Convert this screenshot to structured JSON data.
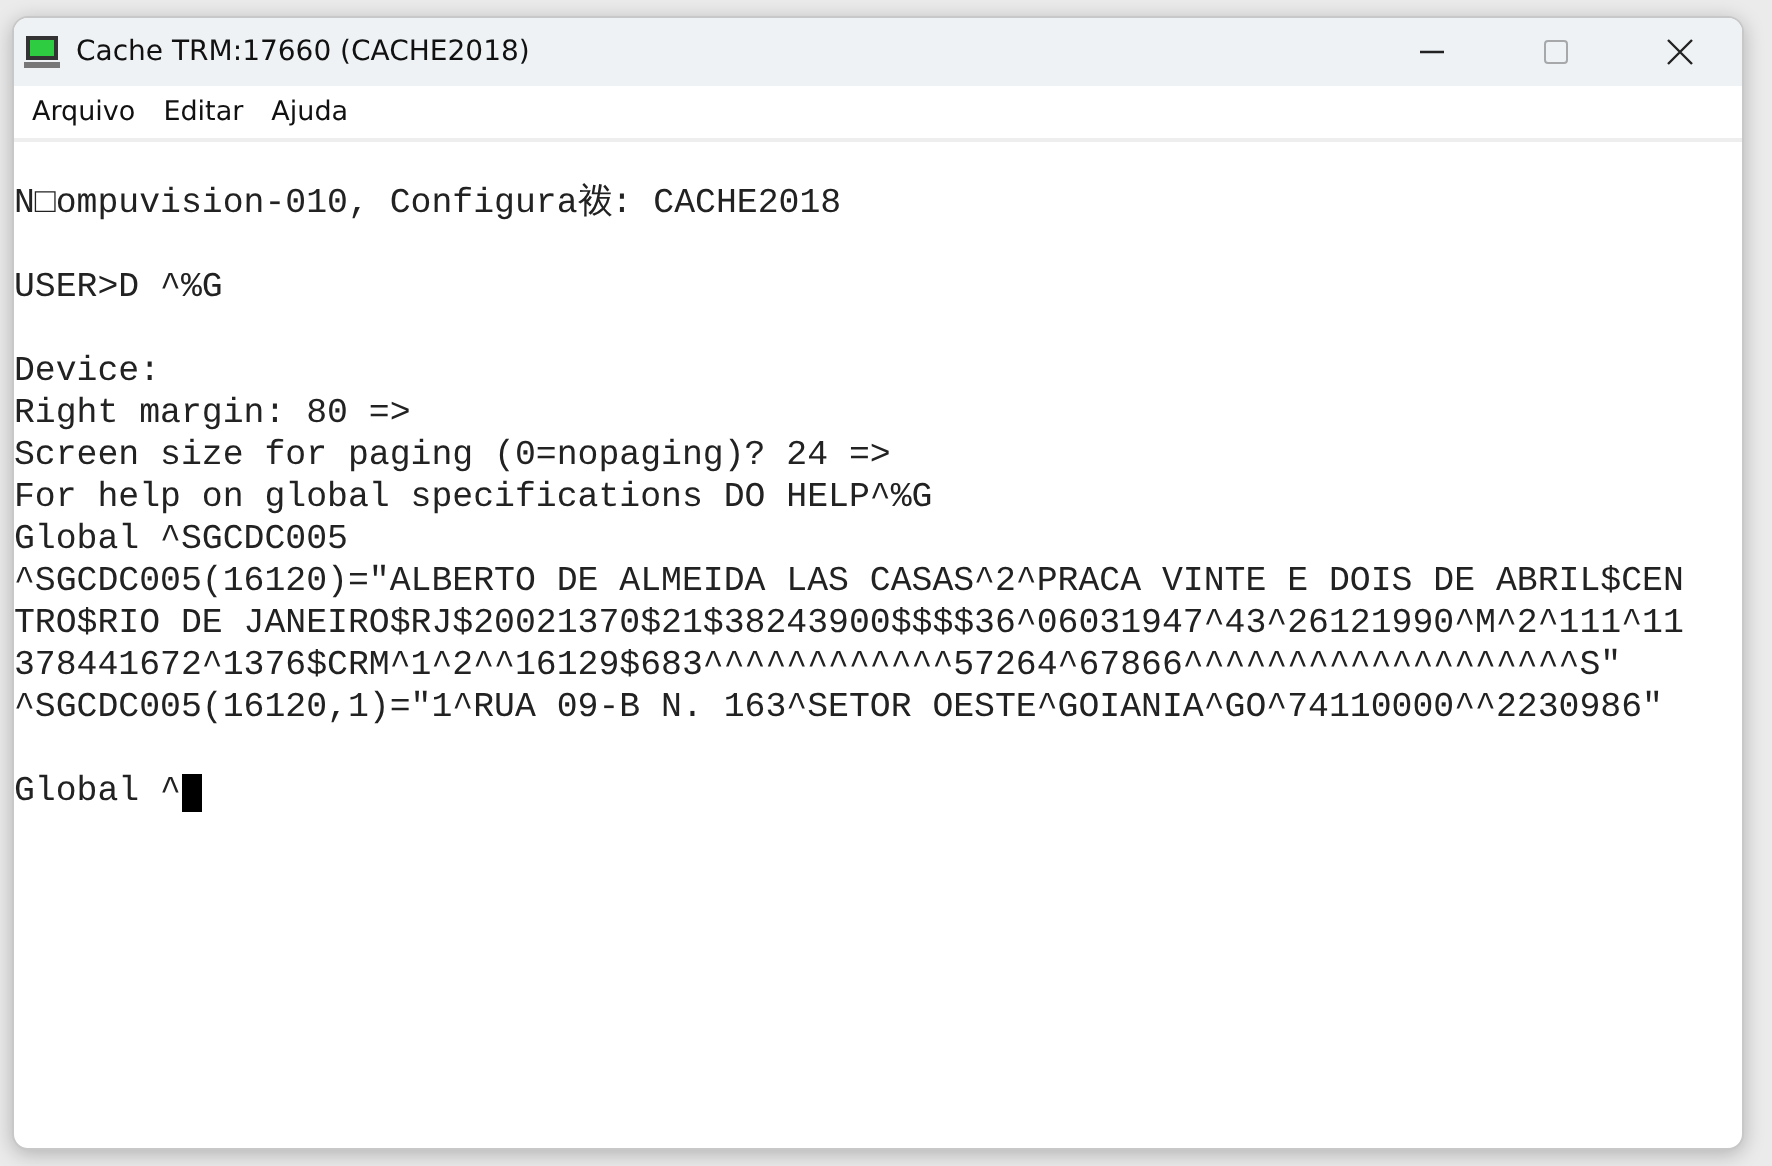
{
  "window": {
    "title": "Cache TRM:17660 (CACHE2018)",
    "controls": [
      {
        "kind": "minimize",
        "disabled": false
      },
      {
        "kind": "maximize",
        "disabled": true
      },
      {
        "kind": "close",
        "disabled": false
      }
    ]
  },
  "menu": [
    "Arquivo",
    "Editar",
    "Ajuda"
  ],
  "terminal": {
    "blocks": [
      [
        "N□ompuvision-010, Configura袯: CACHE2018"
      ],
      [
        "USER>D ^%G"
      ],
      [
        "Device:",
        "Right margin: 80 =>",
        "Screen size for paging (0=nopaging)? 24 =>",
        "For help on global specifications DO HELP^%G",
        "Global ^SGCDC005",
        "^SGCDC005(16120)=\"ALBERTO DE ALMEIDA LAS CASAS^2^PRACA VINTE E DOIS DE ABRIL$CEN",
        "TRO$RIO DE JANEIRO$RJ$20021370$21$38243900$$$$36^06031947^43^26121990^M^2^111^11",
        "378441672^1376$CRM^1^2^^16129$683^^^^^^^^^^^^57264^67866^^^^^^^^^^^^^^^^^^^S\"",
        "^SGCDC005(16120,1)=\"1^RUA 09-B N. 163^SETOR OESTE^GOIANIA^GO^74110000^^2230986\""
      ]
    ],
    "prompt": "Global ^"
  }
}
